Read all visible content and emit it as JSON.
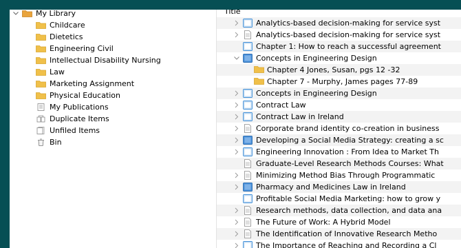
{
  "library": {
    "root_label": "My Library",
    "items": [
      {
        "label": "Childcare",
        "icon": "folder-icon",
        "name": "collection-childcare"
      },
      {
        "label": "Dietetics",
        "icon": "folder-icon",
        "name": "collection-dietetics"
      },
      {
        "label": "Engineering Civil",
        "icon": "folder-icon",
        "name": "collection-engineering-civil"
      },
      {
        "label": "Intellectual Disability Nursing",
        "icon": "folder-icon",
        "name": "collection-intellectual-disability-nursing"
      },
      {
        "label": "Law",
        "icon": "folder-icon",
        "name": "collection-law"
      },
      {
        "label": "Marketing Assignment",
        "icon": "folder-icon",
        "name": "collection-marketing-assignment"
      },
      {
        "label": "Physical Education",
        "icon": "folder-icon",
        "name": "collection-physical-education"
      },
      {
        "label": "My Publications",
        "icon": "publications-icon",
        "name": "my-publications"
      },
      {
        "label": "Duplicate Items",
        "icon": "duplicate-icon",
        "name": "duplicate-items"
      },
      {
        "label": "Unfiled Items",
        "icon": "unfiled-icon",
        "name": "unfiled-items"
      },
      {
        "label": "Bin",
        "icon": "trash-icon",
        "name": "bin"
      }
    ]
  },
  "items_pane": {
    "column_title": "Title",
    "rows": [
      {
        "title": "Analytics-based decision-making for service syst",
        "icon": "book-icon",
        "twisty": true,
        "child": false
      },
      {
        "title": "Analytics-based decision-making for service syst",
        "icon": "document-icon",
        "twisty": true,
        "child": false
      },
      {
        "title": "Chapter 1: How to reach a successful agreement",
        "icon": "book-icon",
        "twisty": false,
        "child": false
      },
      {
        "title": "Concepts in Engineering Design",
        "icon": "book-dark-icon",
        "twisty": true,
        "expanded": true,
        "child": false
      },
      {
        "title": "Chapter 4 Jones, Susan, pgs 12 -32",
        "icon": "folder-icon",
        "twisty": false,
        "child": true
      },
      {
        "title": "Chapter 7 - Murphy, James pages 77-89",
        "icon": "folder-icon",
        "twisty": false,
        "child": true
      },
      {
        "title": "Concepts in Engineering Design",
        "icon": "book-icon",
        "twisty": true,
        "child": false
      },
      {
        "title": "Contract Law",
        "icon": "book-icon",
        "twisty": true,
        "child": false
      },
      {
        "title": "Contract Law in Ireland",
        "icon": "book-icon",
        "twisty": true,
        "child": false
      },
      {
        "title": "Corporate brand identity co-creation in business",
        "icon": "document-icon",
        "twisty": true,
        "child": false
      },
      {
        "title": "Developing a Social Media Strategy: creating a sc",
        "icon": "book-dark-icon",
        "twisty": true,
        "child": false
      },
      {
        "title": "Engineering Innovation : From Idea to Market Th",
        "icon": "book-icon",
        "twisty": true,
        "child": false
      },
      {
        "title": "Graduate-Level Research Methods Courses: What",
        "icon": "document-icon",
        "twisty": false,
        "child": false
      },
      {
        "title": "Minimizing Method Bias Through Programmatic",
        "icon": "document-icon",
        "twisty": true,
        "child": false
      },
      {
        "title": "Pharmacy and Medicines Law in Ireland",
        "icon": "book-dark-icon",
        "twisty": true,
        "child": false
      },
      {
        "title": "Profitable Social Media Marketing: how to grow y",
        "icon": "book-icon",
        "twisty": false,
        "child": false
      },
      {
        "title": "Research methods, data collection, and data ana",
        "icon": "document-icon",
        "twisty": true,
        "child": false
      },
      {
        "title": "The Future of Work: A Hybrid Model",
        "icon": "document-icon",
        "twisty": true,
        "child": false
      },
      {
        "title": "The Identification of Innovative Research Metho",
        "icon": "document-icon",
        "twisty": true,
        "child": false
      },
      {
        "title": "The Importance of Reaching and Recording a Cl",
        "icon": "book-icon",
        "twisty": true,
        "child": false
      }
    ]
  },
  "colors": {
    "background": "#064f54",
    "folder": "#f0c04a",
    "book_blue": "#3f8fd8",
    "alt_row": "#f3f3f3",
    "selected_row": "#e8e8e8"
  }
}
